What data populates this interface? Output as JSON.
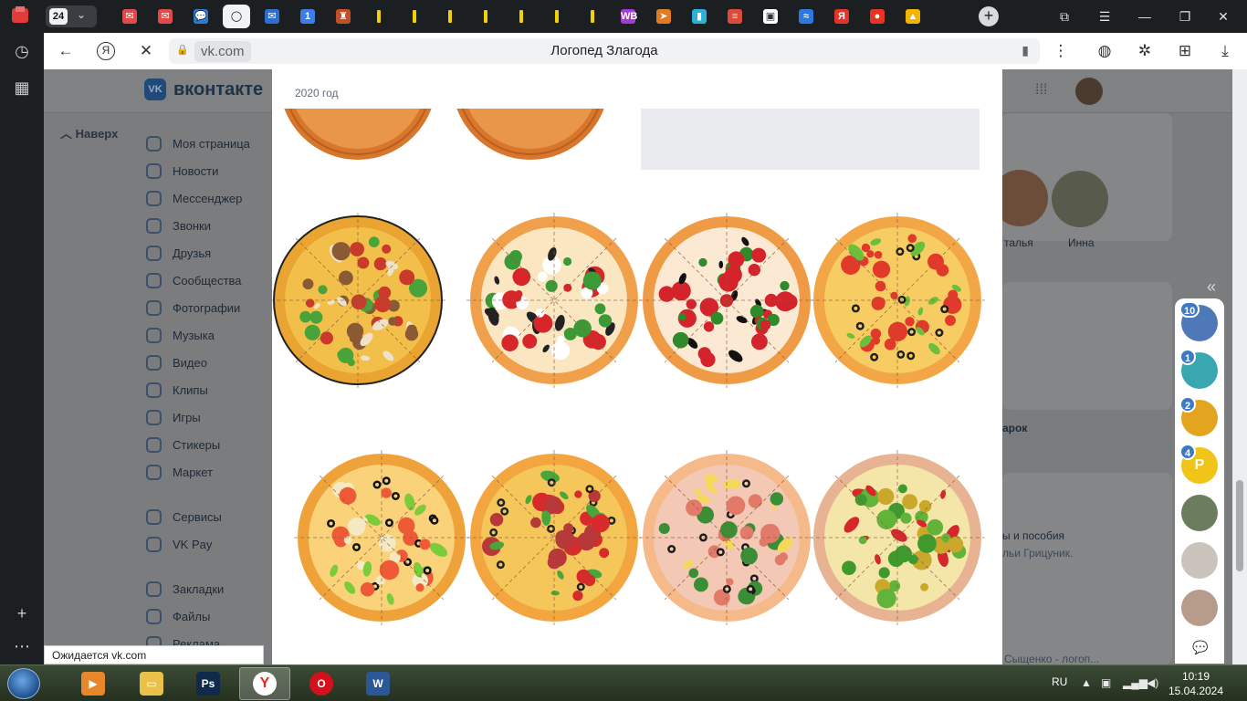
{
  "tabs": {
    "count": "24",
    "favicons": [
      {
        "icon": "vk-mail-icon",
        "color": "#e24a4a",
        "glyph": "✉"
      },
      {
        "icon": "vk-mail-icon",
        "color": "#e24a4a",
        "glyph": "✉"
      },
      {
        "icon": "chat-icon",
        "color": "#2a7bd6",
        "glyph": "💬"
      },
      {
        "icon": "yandex-browser-icon",
        "color": "#111111",
        "glyph": "◯"
      },
      {
        "icon": "mail-icon",
        "color": "#2f6ed1",
        "glyph": "✉"
      },
      {
        "icon": "notification-one-icon",
        "color": "#3d7ee6",
        "glyph": "1"
      },
      {
        "icon": "figure-icon",
        "color": "#c0502a",
        "glyph": "♜"
      },
      {
        "icon": "yellow-bar-icon",
        "color": "#f5d000",
        "glyph": "i"
      },
      {
        "icon": "yellow-bar-icon",
        "color": "#f5d000",
        "glyph": "i"
      },
      {
        "icon": "yellow-bar-icon",
        "color": "#f5d000",
        "glyph": "i"
      },
      {
        "icon": "yellow-bar-icon",
        "color": "#f5d000",
        "glyph": "i"
      },
      {
        "icon": "yellow-bar-icon",
        "color": "#f5d000",
        "glyph": "i"
      },
      {
        "icon": "yellow-bar-icon",
        "color": "#f5d000",
        "glyph": "i"
      },
      {
        "icon": "yellow-bar-icon",
        "color": "#f5d000",
        "glyph": "i"
      },
      {
        "icon": "wildberries-icon",
        "color": "#a53ad1",
        "glyph": "WB"
      },
      {
        "icon": "paper-plane-icon",
        "color": "#e07b22",
        "glyph": "➤"
      },
      {
        "icon": "book-icon",
        "color": "#2bb0d6",
        "glyph": "▮"
      },
      {
        "icon": "news-icon",
        "color": "#d94c3b",
        "glyph": "≡"
      },
      {
        "icon": "gift-icon",
        "color": "#ffffff",
        "glyph": "▣"
      },
      {
        "icon": "wave-icon",
        "color": "#2c78e0",
        "glyph": "≈"
      },
      {
        "icon": "yandex-icon",
        "color": "#e5332a",
        "glyph": "Я"
      },
      {
        "icon": "drop-icon",
        "color": "#e53326",
        "glyph": "●"
      },
      {
        "icon": "picture-icon",
        "color": "#f1b400",
        "glyph": "▲"
      }
    ]
  },
  "navbar": {
    "domain": "vk.com",
    "page_title": "Логопед Злагода"
  },
  "vk": {
    "brand": "вконтакте",
    "back_to_top": "Наверх",
    "menu": [
      "Моя страница",
      "Новости",
      "Мессенджер",
      "Звонки",
      "Друзья",
      "Сообщества",
      "Фотографии",
      "Музыка",
      "Видео",
      "Клипы",
      "Игры",
      "Стикеры",
      "Маркет"
    ],
    "menu2": [
      "Сервисы",
      "VK Pay"
    ],
    "menu3": [
      "Закладки",
      "Файлы",
      "Реклама"
    ],
    "friend_name_1": "талья",
    "friend_name_2": "Инна",
    "gift_label": "арок",
    "post_text_1": "ы и пособия",
    "post_text_2": "льи Грицуник.",
    "post_text_3": "Сыщенко - логоп..."
  },
  "viewer": {
    "year_label": "2020 год"
  },
  "chats": [
    {
      "badge": "10",
      "color": "#4e78b8"
    },
    {
      "badge": "1",
      "color": "#3aa7b0"
    },
    {
      "badge": "2",
      "color": "#e3a520"
    },
    {
      "badge": "4",
      "color": "#f0c419",
      "letter": "P"
    },
    {
      "badge": "",
      "color": "#6b7d5e"
    },
    {
      "badge": "",
      "color": "#c9c3bc"
    },
    {
      "badge": "",
      "color": "#b79c8b"
    }
  ],
  "status_text": "Ожидается vk.com",
  "tray": {
    "lang": "RU",
    "time": "10:19",
    "date": "15.04.2024"
  },
  "taskbar": [
    {
      "name": "media-player-icon",
      "color": "#e8872a",
      "glyph": "▶"
    },
    {
      "name": "file-explorer-icon",
      "color": "#e9c14a",
      "glyph": "▭"
    },
    {
      "name": "photoshop-icon",
      "color": "#0f2a4a",
      "glyph": "Ps"
    },
    {
      "name": "yandex-browser-icon",
      "color": "#ffffff",
      "glyph": "Y"
    },
    {
      "name": "opera-icon",
      "color": "#d4101c",
      "glyph": "O"
    },
    {
      "name": "word-icon",
      "color": "#2b5797",
      "glyph": "W"
    }
  ]
}
